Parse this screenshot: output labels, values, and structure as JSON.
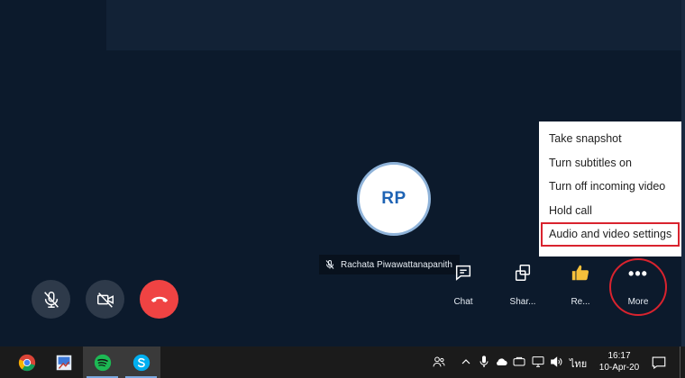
{
  "call": {
    "avatar_initials": "RP",
    "participant_name": "Rachata Piwawattanapanith"
  },
  "controls": {
    "chat_label": "Chat",
    "share_label": "Shar...",
    "react_label": "Re...",
    "more_label": "More",
    "more_glyph": "•••"
  },
  "menu": {
    "items": [
      {
        "label": "Take snapshot"
      },
      {
        "label": "Turn subtitles on"
      },
      {
        "label": "Turn off incoming video"
      },
      {
        "label": "Hold call"
      },
      {
        "label": "Audio and video settings"
      }
    ]
  },
  "taskbar": {
    "apps": [
      "chrome-icon",
      "paint-icon",
      "spotify-icon",
      "skype-icon"
    ],
    "language": "ไทย",
    "time": "16:17",
    "date": "10-Apr-20"
  },
  "colors": {
    "end_call": "#ef4343",
    "highlight": "#d9232e",
    "avatar_text": "#1e63b4",
    "background": "#0c1a2c"
  }
}
